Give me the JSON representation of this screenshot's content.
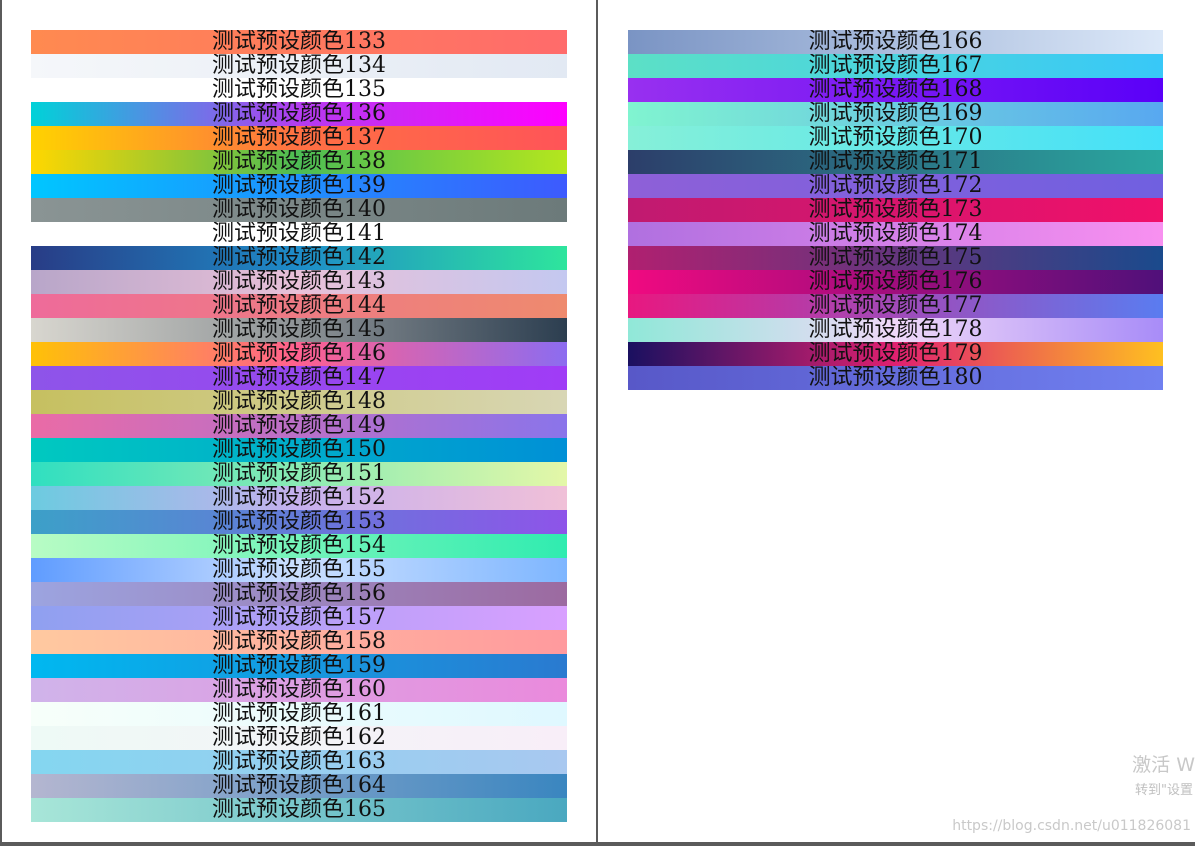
{
  "left_page": {
    "bands": [
      {
        "label": "测试预设颜色133",
        "gradient": [
          "#ff8a50",
          "#ff6b6b"
        ]
      },
      {
        "label": "测试预设颜色134",
        "gradient": [
          "#f5f7fa",
          "#e2e9f3"
        ]
      },
      {
        "label": "测试预设颜色135",
        "gradient": [
          "#ffffff",
          "#ffffff"
        ]
      },
      {
        "label": "测试预设颜色136",
        "gradient": [
          "#00d2d8",
          "#b43cf0",
          "#ff00ff"
        ]
      },
      {
        "label": "测试预设颜色137",
        "gradient": [
          "#ffd200",
          "#ff7043",
          "#ff5458"
        ]
      },
      {
        "label": "测试预设颜色138",
        "gradient": [
          "#ffd700",
          "#4cbc54",
          "#b4e61e"
        ]
      },
      {
        "label": "测试预设颜色139",
        "gradient": [
          "#00c6ff",
          "#3d5afe"
        ]
      },
      {
        "label": "测试预设颜色140",
        "gradient": [
          "#8a9494",
          "#6c7a7a"
        ]
      },
      {
        "label": "测试预设颜色141",
        "gradient": [
          "#ffffff",
          "#ffffff"
        ]
      },
      {
        "label": "测试预设颜色142",
        "gradient": [
          "#283c86",
          "#1e8cc8",
          "#2ee59d"
        ]
      },
      {
        "label": "测试预设颜色143",
        "gradient": [
          "#b8a6c9",
          "#e8c0d8",
          "#c4c8f0"
        ]
      },
      {
        "label": "测试预设颜色144",
        "gradient": [
          "#ee6b9a",
          "#ee8a6e"
        ]
      },
      {
        "label": "测试预设颜色145",
        "gradient": [
          "#d8d6cf",
          "#8e9396",
          "#2c3e50"
        ]
      },
      {
        "label": "测试预设颜色146",
        "gradient": [
          "#ffc107",
          "#ff6090",
          "#8c6cf0"
        ]
      },
      {
        "label": "测试预设颜色147",
        "gradient": [
          "#8e54e9",
          "#a03cf6"
        ]
      },
      {
        "label": "测试预设颜色148",
        "gradient": [
          "#c6c060",
          "#d8d6b4"
        ]
      },
      {
        "label": "测试预设颜色149",
        "gradient": [
          "#ea6ba6",
          "#8a74ea"
        ]
      },
      {
        "label": "测试预设颜色150",
        "gradient": [
          "#00c9c0",
          "#0090d6"
        ]
      },
      {
        "label": "测试预设颜色151",
        "gradient": [
          "#30dfc0",
          "#e4f7a8"
        ]
      },
      {
        "label": "测试预设颜色152",
        "gradient": [
          "#6ccbe0",
          "#c6b0ee",
          "#f0c0d8"
        ]
      },
      {
        "label": "测试预设颜色153",
        "gradient": [
          "#3ca0c8",
          "#8e54e9"
        ]
      },
      {
        "label": "测试预设颜色154",
        "gradient": [
          "#b8fcc4",
          "#30ecb0"
        ]
      },
      {
        "label": "测试预设颜色155",
        "gradient": [
          "#5f9cff",
          "#cce0ff",
          "#7eb6ff"
        ]
      },
      {
        "label": "测试预设颜色156",
        "gradient": [
          "#9ca4e0",
          "#9c6aa0"
        ]
      },
      {
        "label": "测试预设颜色157",
        "gradient": [
          "#8fa0f0",
          "#d9a0ff"
        ]
      },
      {
        "label": "测试预设颜色158",
        "gradient": [
          "#ffc9a0",
          "#ff9a9e"
        ]
      },
      {
        "label": "测试预设颜色159",
        "gradient": [
          "#00b8f0",
          "#2a7ad0"
        ]
      },
      {
        "label": "测试预设颜色160",
        "gradient": [
          "#d0b4ea",
          "#ea8adc"
        ]
      },
      {
        "label": "测试预设颜色161",
        "gradient": [
          "#f7fffa",
          "#dff8ff"
        ]
      },
      {
        "label": "测试预设颜色162",
        "gradient": [
          "#eefaf6",
          "#f8eef8"
        ]
      },
      {
        "label": "测试预设颜色163",
        "gradient": [
          "#84d6f0",
          "#a8c8f0"
        ]
      },
      {
        "label": "测试预设颜色164",
        "gradient": [
          "#b4b6d0",
          "#3a86c0"
        ]
      },
      {
        "label": "测试预设颜色165",
        "gradient": [
          "#a8e6d8",
          "#4aa8c0"
        ]
      }
    ]
  },
  "right_page": {
    "bands": [
      {
        "label": "测试预设颜色166",
        "gradient": [
          "#7a94c4",
          "#dce8f8"
        ]
      },
      {
        "label": "测试预设颜色167",
        "gradient": [
          "#5ce0c6",
          "#38c8f8"
        ]
      },
      {
        "label": "测试预设颜色168",
        "gradient": [
          "#9830f0",
          "#5a00f8"
        ]
      },
      {
        "label": "测试预设颜色169",
        "gradient": [
          "#80f4d0",
          "#58a8f0"
        ]
      },
      {
        "label": "测试预设颜色170",
        "gradient": [
          "#86f0d8",
          "#44e0f8"
        ]
      },
      {
        "label": "测试预设颜色171",
        "gradient": [
          "#2c3e6a",
          "#2aa8a0"
        ]
      },
      {
        "label": "测试预设颜色172",
        "gradient": [
          "#8e60d8",
          "#7060e0"
        ]
      },
      {
        "label": "测试预设颜色173",
        "gradient": [
          "#c01a70",
          "#f0106a"
        ]
      },
      {
        "label": "测试预设颜色174",
        "gradient": [
          "#b070e0",
          "#f890f0"
        ]
      },
      {
        "label": "测试预设颜色175",
        "gradient": [
          "#b02070",
          "#1a4a8c"
        ]
      },
      {
        "label": "测试预设颜色176",
        "gradient": [
          "#f00a80",
          "#50107a"
        ]
      },
      {
        "label": "测试预设颜色177",
        "gradient": [
          "#e81880",
          "#5a7cf0"
        ]
      },
      {
        "label": "测试预设颜色178",
        "gradient": [
          "#90e8d8",
          "#f0d8f8",
          "#a88cf8"
        ]
      },
      {
        "label": "测试预设颜色179",
        "gradient": [
          "#1a1060",
          "#e02070",
          "#ffc020"
        ]
      },
      {
        "label": "测试预设颜色180",
        "gradient": [
          "#5858c8",
          "#7080f0"
        ]
      }
    ]
  },
  "watermarks": {
    "activate": "激活 W",
    "settings": "转到\"设置",
    "url": "https://blog.csdn.net/u011826081"
  }
}
